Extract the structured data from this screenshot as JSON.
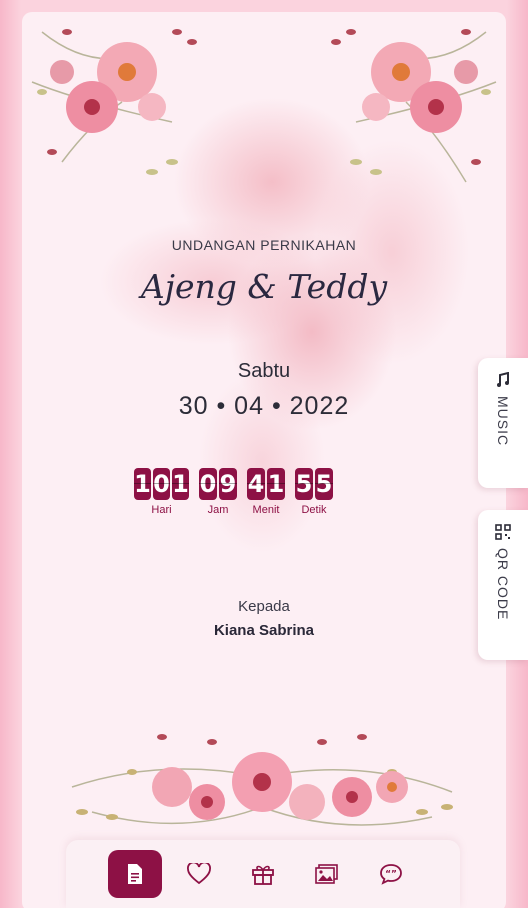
{
  "invitation": {
    "subtitle": "UNDANGAN PERNIKAHAN",
    "couple_names": "Ajeng & Teddy",
    "day": "Sabtu",
    "date": "30 • 04 • 2022"
  },
  "countdown": {
    "units": [
      {
        "digits": [
          "1",
          "0",
          "1"
        ],
        "label": "Hari"
      },
      {
        "digits": [
          "0",
          "9"
        ],
        "label": "Jam"
      },
      {
        "digits": [
          "4",
          "1"
        ],
        "label": "Menit"
      },
      {
        "digits": [
          "5",
          "5"
        ],
        "label": "Detik"
      }
    ]
  },
  "recipient": {
    "label": "Kepada",
    "name": "Kiana Sabrina"
  },
  "side_tabs": {
    "music_label": "MUSIC",
    "qr_label": "QR CODE"
  },
  "bottom_nav": {
    "items": [
      {
        "icon": "document-icon",
        "active": true
      },
      {
        "icon": "heart-icon",
        "active": false
      },
      {
        "icon": "gift-icon",
        "active": false
      },
      {
        "icon": "gallery-icon",
        "active": false
      },
      {
        "icon": "chat-quote-icon",
        "active": false
      }
    ]
  },
  "colors": {
    "accent": "#8d1145",
    "background": "#fdeff4",
    "outer": "#fbd3de"
  }
}
